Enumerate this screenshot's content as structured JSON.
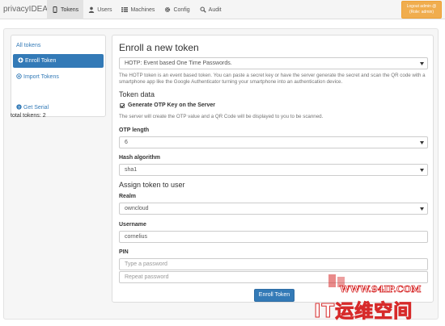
{
  "app": {
    "brand": "privacyIDEA"
  },
  "nav": [
    {
      "label": "Tokens",
      "icon": "phone-icon",
      "active": true
    },
    {
      "label": "Users",
      "icon": "user-icon",
      "active": false
    },
    {
      "label": "Machines",
      "icon": "list-icon",
      "active": false
    },
    {
      "label": "Config",
      "icon": "gear-icon",
      "active": false
    },
    {
      "label": "Audit",
      "icon": "search-icon",
      "active": false
    }
  ],
  "logout": {
    "line1": "Logout admin @",
    "line2": "(Role: admin)"
  },
  "sidebar": {
    "items": [
      {
        "label": "All tokens",
        "active": false
      },
      {
        "label": "Enroll Token",
        "active": true,
        "icon": "plus-circle-icon"
      },
      {
        "label": "Import Tokens",
        "active": false,
        "icon": "import-circle-icon"
      },
      {
        "label": "Get Serial",
        "active": false,
        "icon": "question-circle-icon"
      }
    ],
    "total": "total tokens: 2"
  },
  "enroll": {
    "title": "Enroll a new token",
    "type_select": "HOTP: Event based One Time Passwords.",
    "description": "The HOTP token is an event based token. You can paste a secret key or have the server generate the secret and scan the QR code with a smartphone app like the Google Authenticator turning your smartphone into an authentication device.",
    "token_data_heading": "Token data",
    "genkey_label": "Generate OTP Key on the Server",
    "genkey_checked": true,
    "genkey_help": "The server will create the OTP value and a QR Code will be displayed to you to be scanned.",
    "otplen_label": "OTP length",
    "otplen_value": "6",
    "hash_label": "Hash algorithm",
    "hash_value": "sha1",
    "assign_heading": "Assign token to user",
    "realm_label": "Realm",
    "realm_value": "owncloud",
    "username_label": "Username",
    "username_value": "cornelius",
    "pin_label": "PIN",
    "pin_placeholder": "Type a password",
    "pin_repeat_placeholder": "Repeat password",
    "submit_label": "Enroll Token"
  },
  "watermark": {
    "site": "WWW.94IP.COM",
    "text": "IT运维空间"
  },
  "colors": {
    "primary": "#337ab7",
    "warning": "#f0ad4e",
    "watermark": "#d72a2a"
  }
}
